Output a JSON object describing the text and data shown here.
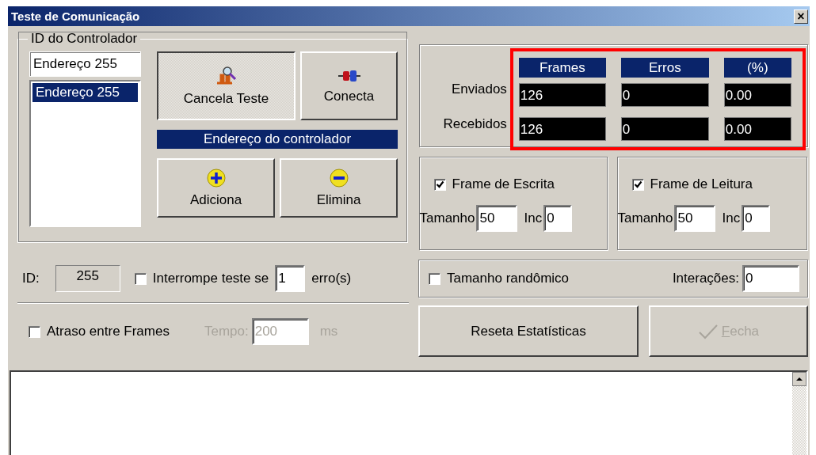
{
  "window": {
    "title": "Teste de Comunicação",
    "close": "×"
  },
  "controller": {
    "title": "ID do Controlador",
    "address_input": "Endereço 255",
    "addresses": [
      {
        "label": "Endereço 255",
        "selected": true
      }
    ],
    "buttons": [
      {
        "label": "Cancela Teste",
        "kind": "test",
        "pressed": true
      },
      {
        "label": "Conecta",
        "kind": "connect",
        "pressed": false
      }
    ],
    "address_caption": "Endereço do controlador",
    "list_buttons": [
      {
        "label": "Adiciona",
        "kind": "add"
      },
      {
        "label": "Elimina",
        "kind": "remove"
      }
    ]
  },
  "stats": {
    "highlighted": true,
    "columns": [
      "Frames",
      "Erros",
      "(%)"
    ],
    "rows": [
      {
        "label": "Enviados",
        "values": [
          "126",
          "0",
          "0.00"
        ]
      },
      {
        "label": "Recebidos",
        "values": [
          "126",
          "0",
          "0.00"
        ]
      }
    ]
  },
  "frames": [
    {
      "label": "Frame de Escrita",
      "checked": true,
      "size_label": "Tamanho",
      "size": "50",
      "inc_label": "Inc",
      "inc": "0"
    },
    {
      "label": "Frame de Leitura",
      "checked": true,
      "size_label": "Tamanho",
      "size": "50",
      "inc_label": "Inc",
      "inc": "0"
    }
  ],
  "id": {
    "label": "ID:",
    "value": "255"
  },
  "interrupt": {
    "label": "Interrompe teste se",
    "checked": false,
    "value": "1",
    "suffix": "erro(s)"
  },
  "random": {
    "label": "Tamanho randômico",
    "checked": false
  },
  "iterations": {
    "label": "Interações:",
    "value": "0"
  },
  "delay": {
    "label": "Atraso entre Frames",
    "checked": false
  },
  "tempo": {
    "label": "Tempo:",
    "value": "200",
    "unit": "ms",
    "disabled": true
  },
  "reset_button": {
    "label": "Reseta Estatísticas"
  },
  "close_button": {
    "label": "Fecha",
    "disabled": true
  }
}
